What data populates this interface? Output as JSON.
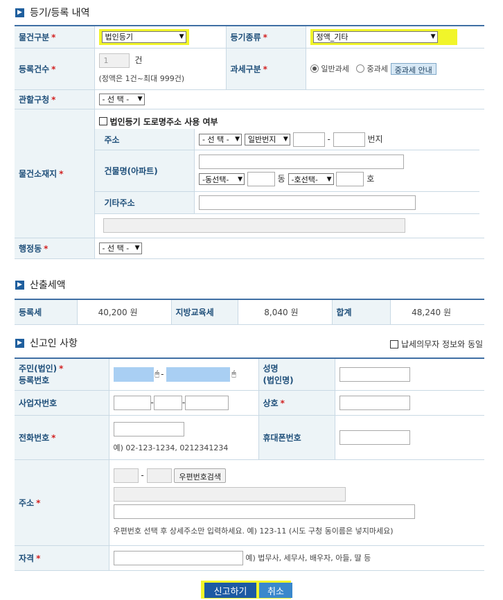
{
  "sections": {
    "registration_title": "등기/등록 내역",
    "tax_title": "산출세액",
    "reporter_title": "신고인 사항"
  },
  "registration": {
    "property_type_label": "물건구분",
    "property_type_value": "법인등기",
    "reg_kind_label": "등기종류",
    "reg_kind_value": "정액_기타",
    "count_label": "등록건수",
    "count_value": "1",
    "count_unit": "건",
    "count_note": "(정액은 1건~최대 999건)",
    "tax_type_label": "과세구분",
    "tax_normal": "일반과세",
    "tax_heavy": "중과세",
    "heavy_guide_button": "중과세 안내",
    "jurisdiction_label": "관할구청",
    "select_default": "- 선 택 -",
    "location_label": "물건소재지",
    "road_address_check": "법인등기 도로명주소 사용 여부",
    "address_label": "주소",
    "lot_type_value": "일반번지",
    "lot_unit": "번지",
    "building_label": "건물명(아파트)",
    "dong_select": "-동선택-",
    "dong_unit": "동",
    "ho_select": "-호선택-",
    "ho_unit": "호",
    "other_address_label": "기타주소",
    "admin_dong_label": "행정동"
  },
  "tax": {
    "reg_tax_label": "등록세",
    "reg_tax_value": "40,200",
    "edu_tax_label": "지방교육세",
    "edu_tax_value": "8,040",
    "total_label": "합계",
    "total_value": "48,240",
    "currency": "원"
  },
  "reporter": {
    "same_as_taxpayer": "납세의무자 정보와 동일",
    "id_label_1": "주민(법인)",
    "id_label_2": "등록번호",
    "name_label_1": "성명",
    "name_label_2": "(법인명)",
    "biz_no_label": "사업자번호",
    "company_label": "상호",
    "phone_label": "전화번호",
    "phone_note": "예) 02-123-1234, 0212341234",
    "mobile_label": "휴대폰번호",
    "address_label": "주소",
    "zip_search_button": "우편번호검색",
    "address_note": "우편번호 선택 후 상세주소만 입력하세요. 예) 123-11 (시도 구청 동이름은 넣지마세요)",
    "qualification_label": "자격",
    "qualification_note": "예) 법무사, 세무사, 배우자, 아들, 딸 등"
  },
  "actions": {
    "submit": "신고하기",
    "cancel": "취소"
  },
  "colors": {
    "accent": "#1f5f9e",
    "label_bg": "#edf4f7",
    "highlight": "#f1f52a",
    "submit_bg": "#1d5aa3",
    "required": "#d22222"
  }
}
